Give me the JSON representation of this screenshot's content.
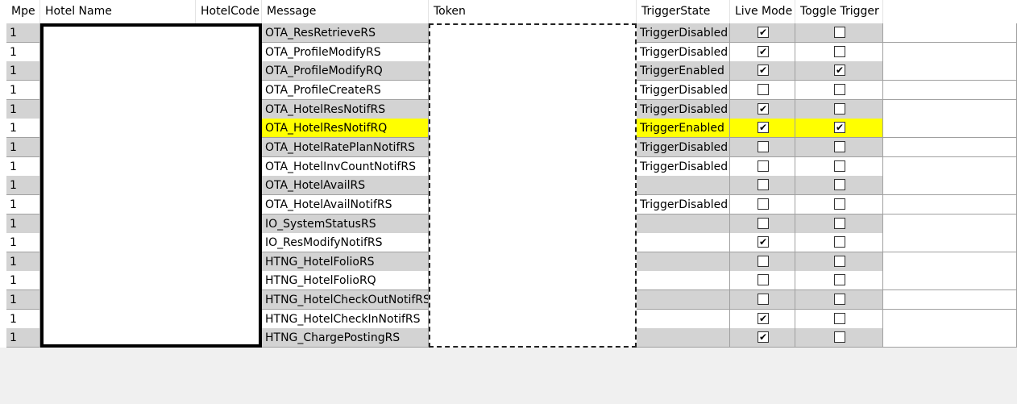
{
  "columns": {
    "mpe": "Mpe",
    "hotel_name": "Hotel Name",
    "hotel_code": "HotelCode",
    "message": "Message",
    "token": "Token",
    "trigger_state": "TriggerState",
    "live_mode": "Live Mode",
    "toggle_trigger": "Toggle Trigger"
  },
  "rows": [
    {
      "mpe": "1",
      "message": "OTA_ResRetrieveRS",
      "trigger_state": "TriggerDisabled",
      "live_mode": true,
      "toggle_trigger": false
    },
    {
      "mpe": "1",
      "message": "OTA_ProfileModifyRS",
      "trigger_state": "TriggerDisabled",
      "live_mode": true,
      "toggle_trigger": false
    },
    {
      "mpe": "1",
      "message": "OTA_ProfileModifyRQ",
      "trigger_state": "TriggerEnabled",
      "live_mode": true,
      "toggle_trigger": true
    },
    {
      "mpe": "1",
      "message": "OTA_ProfileCreateRS",
      "trigger_state": "TriggerDisabled",
      "live_mode": false,
      "toggle_trigger": false
    },
    {
      "mpe": "1",
      "message": "OTA_HotelResNotifRS",
      "trigger_state": "TriggerDisabled",
      "live_mode": true,
      "toggle_trigger": false
    },
    {
      "mpe": "1",
      "message": "OTA_HotelResNotifRQ",
      "trigger_state": "TriggerEnabled",
      "live_mode": true,
      "toggle_trigger": true,
      "highlight": true
    },
    {
      "mpe": "1",
      "message": "OTA_HotelRatePlanNotifRS",
      "trigger_state": "TriggerDisabled",
      "live_mode": false,
      "toggle_trigger": false
    },
    {
      "mpe": "1",
      "message": "OTA_HotelInvCountNotifRS",
      "trigger_state": "TriggerDisabled",
      "live_mode": false,
      "toggle_trigger": false
    },
    {
      "mpe": "1",
      "message": "OTA_HotelAvailRS",
      "trigger_state": "",
      "live_mode": false,
      "toggle_trigger": false
    },
    {
      "mpe": "1",
      "message": "OTA_HotelAvailNotifRS",
      "trigger_state": "TriggerDisabled",
      "live_mode": false,
      "toggle_trigger": false
    },
    {
      "mpe": "1",
      "message": "IO_SystemStatusRS",
      "trigger_state": "",
      "live_mode": false,
      "toggle_trigger": false
    },
    {
      "mpe": "1",
      "message": "IO_ResModifyNotifRS",
      "trigger_state": "",
      "live_mode": true,
      "toggle_trigger": false
    },
    {
      "mpe": "1",
      "message": "HTNG_HotelFolioRS",
      "trigger_state": "",
      "live_mode": false,
      "toggle_trigger": false
    },
    {
      "mpe": "1",
      "message": "HTNG_HotelFolioRQ",
      "trigger_state": "",
      "live_mode": false,
      "toggle_trigger": false
    },
    {
      "mpe": "1",
      "message": "HTNG_HotelCheckOutNotifRS",
      "trigger_state": "",
      "live_mode": false,
      "toggle_trigger": false
    },
    {
      "mpe": "1",
      "message": "HTNG_HotelCheckInNotifRS",
      "trigger_state": "",
      "live_mode": true,
      "toggle_trigger": false
    },
    {
      "mpe": "1",
      "message": "HTNG_ChargePostingRS",
      "trigger_state": "",
      "live_mode": true,
      "toggle_trigger": false
    }
  ],
  "colors": {
    "alt_row": "#d3d3d3",
    "highlight": "#ffff00",
    "background": "#f0f0f0"
  },
  "icons": {
    "checked": "check-mark-icon"
  }
}
